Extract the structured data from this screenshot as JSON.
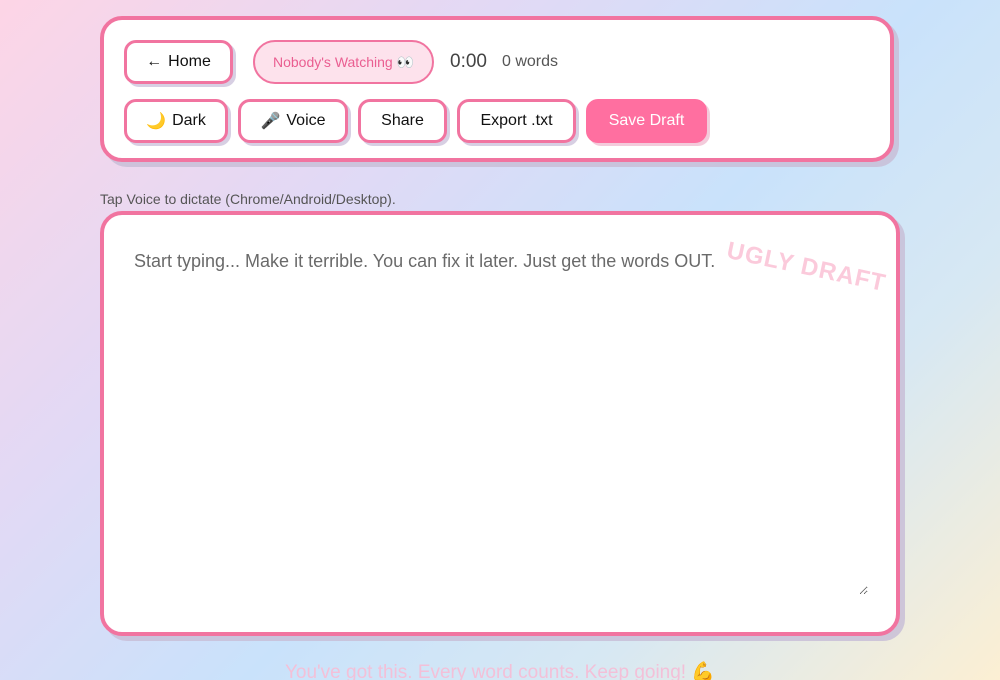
{
  "toolbar": {
    "home": {
      "icon": "←",
      "label": "Home"
    },
    "status_pill": "Nobody's Watching 👀",
    "timer": "0:00",
    "word_count": "0 words",
    "dark": {
      "icon": "🌙",
      "label": "Dark"
    },
    "voice": {
      "icon": "🎤",
      "label": "Voice"
    },
    "share_label": "Share",
    "export_label": "Export .txt",
    "save_label": "Save Draft"
  },
  "hint": "Tap Voice to dictate (Chrome/Android/Desktop).",
  "editor": {
    "value": "",
    "placeholder": "Start typing... Make it terrible. You can fix it later. Just get the words OUT.",
    "watermark": "UGLY DRAFT"
  },
  "footer": {
    "encouragement": "You've got this. Every word counts. Keep going! 💪"
  },
  "colors": {
    "accent": "#f174a0",
    "primary_button": "#ff6fa0",
    "pill_background": "#fde2ec"
  }
}
